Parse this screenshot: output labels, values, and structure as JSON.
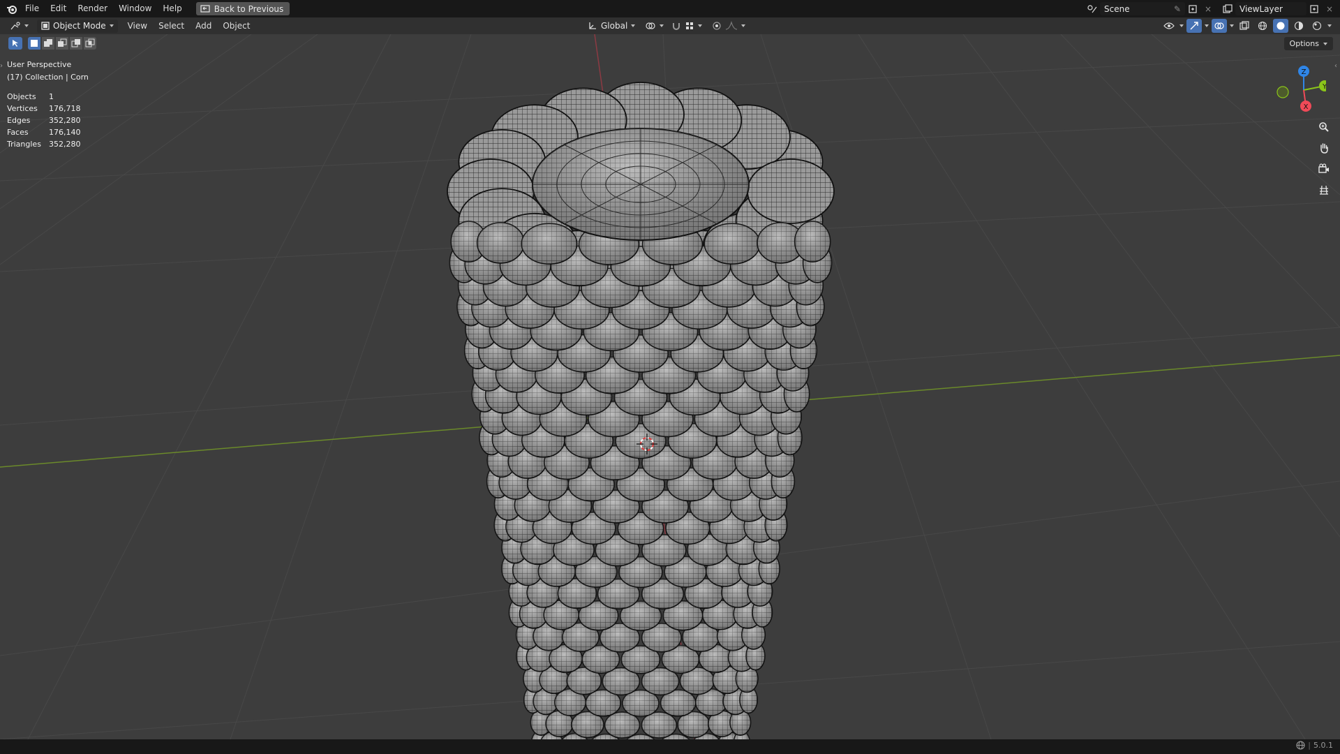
{
  "menu": {
    "items": [
      "File",
      "Edit",
      "Render",
      "Window",
      "Help"
    ],
    "back_label": "Back to Previous"
  },
  "scene": {
    "scene_name": "Scene",
    "view_layer": "ViewLayer"
  },
  "header": {
    "mode_label": "Object Mode",
    "menus": [
      "View",
      "Select",
      "Add",
      "Object"
    ],
    "orientation": "Global",
    "options_label": "Options"
  },
  "overlay": {
    "perspective": "User Perspective",
    "collection": "(17) Collection | Corn",
    "stats": [
      {
        "label": "Objects",
        "value": "1"
      },
      {
        "label": "Vertices",
        "value": "176,718"
      },
      {
        "label": "Edges",
        "value": "352,280"
      },
      {
        "label": "Faces",
        "value": "176,140"
      },
      {
        "label": "Triangles",
        "value": "352,280"
      }
    ]
  },
  "gizmo": {
    "x": "X",
    "y": "Y",
    "z": "Z"
  },
  "status": {
    "version": "5.0.1"
  },
  "colors": {
    "x_axis": "#f04a58",
    "y_axis": "#8bc51a",
    "z_axis": "#2f86e8",
    "accent": "#4772b3"
  },
  "icons": [
    "blender-logo-icon",
    "zoom-icon",
    "hand-pan-icon",
    "camera-icon",
    "ortho-grid-icon",
    "globe-icon"
  ]
}
